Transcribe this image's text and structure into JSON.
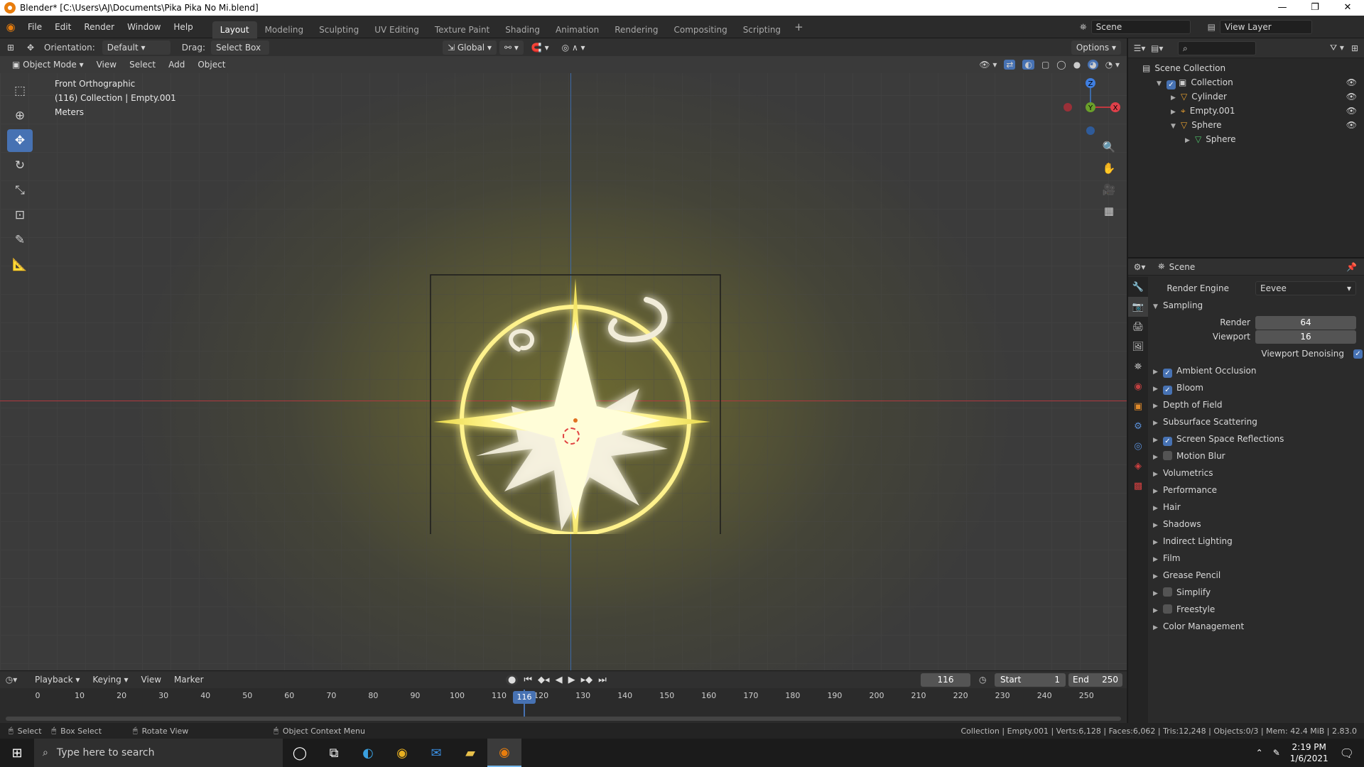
{
  "window": {
    "title": "Blender* [C:\\Users\\AJ\\Documents\\Pika Pika No Mi.blend]",
    "min": "—",
    "restore": "❐",
    "close": "✕"
  },
  "menus": [
    "File",
    "Edit",
    "Render",
    "Window",
    "Help"
  ],
  "workspaces": [
    "Layout",
    "Modeling",
    "Sculpting",
    "UV Editing",
    "Texture Paint",
    "Shading",
    "Animation",
    "Rendering",
    "Compositing",
    "Scripting"
  ],
  "active_workspace": "Layout",
  "scene_name": "Scene",
  "view_layer": "View Layer",
  "tool_header": {
    "orientation_label": "Orientation:",
    "orientation_value": "Default",
    "drag_label": "Drag:",
    "drag_value": "Select Box",
    "transform_value": "Global",
    "options_label": "Options"
  },
  "viewport_header": {
    "mode": "Object Mode",
    "menus": [
      "View",
      "Select",
      "Add",
      "Object"
    ]
  },
  "viewport_info": {
    "line1": "Front Orthographic",
    "line2": "(116) Collection | Empty.001",
    "line3": "Meters"
  },
  "gizmo": {
    "z": "Z",
    "y": "Y",
    "x": "X"
  },
  "outliner": {
    "rows": [
      {
        "label": "Scene Collection",
        "indent": 0
      },
      {
        "label": "Collection",
        "indent": 1
      },
      {
        "label": "Cylinder",
        "indent": 2
      },
      {
        "label": "Empty.001",
        "indent": 2
      },
      {
        "label": "Sphere",
        "indent": 2
      },
      {
        "label": "Sphere",
        "indent": 3
      }
    ]
  },
  "properties": {
    "context": "Scene",
    "render_engine_label": "Render Engine",
    "render_engine_value": "Eevee",
    "sampling_label": "Sampling",
    "render_label": "Render",
    "render_value": "64",
    "viewport_label": "Viewport",
    "viewport_value": "16",
    "viewport_denoising_label": "Viewport Denoising",
    "panels": [
      {
        "label": "Ambient Occlusion",
        "checkbox": true,
        "checked": true
      },
      {
        "label": "Bloom",
        "checkbox": true,
        "checked": true
      },
      {
        "label": "Depth of Field",
        "checkbox": false
      },
      {
        "label": "Subsurface Scattering",
        "checkbox": false
      },
      {
        "label": "Screen Space Reflections",
        "checkbox": true,
        "checked": true
      },
      {
        "label": "Motion Blur",
        "checkbox": true,
        "checked": false
      },
      {
        "label": "Volumetrics",
        "checkbox": false
      },
      {
        "label": "Performance",
        "checkbox": false
      },
      {
        "label": "Hair",
        "checkbox": false
      },
      {
        "label": "Shadows",
        "checkbox": false
      },
      {
        "label": "Indirect Lighting",
        "checkbox": false
      },
      {
        "label": "Film",
        "checkbox": false
      },
      {
        "label": "Grease Pencil",
        "checkbox": false
      },
      {
        "label": "Simplify",
        "checkbox": true,
        "checked": false
      },
      {
        "label": "Freestyle",
        "checkbox": true,
        "checked": false
      },
      {
        "label": "Color Management",
        "checkbox": false
      }
    ]
  },
  "timeline": {
    "menus": [
      "Playback",
      "Keying",
      "View",
      "Marker"
    ],
    "current_frame": "116",
    "start_label": "Start",
    "start_value": "1",
    "end_label": "End",
    "end_value": "250",
    "ticks": [
      "0",
      "10",
      "20",
      "30",
      "40",
      "50",
      "60",
      "70",
      "80",
      "90",
      "100",
      "110",
      "120",
      "130",
      "140",
      "150",
      "160",
      "170",
      "180",
      "190",
      "200",
      "210",
      "220",
      "230",
      "240",
      "250"
    ]
  },
  "statusbar": {
    "select": "Select",
    "box_select": "Box Select",
    "rotate_view": "Rotate View",
    "context_menu": "Object Context Menu",
    "stats": "Collection | Empty.001 | Verts:6,128 | Faces:6,062 | Tris:12,248 | Objects:0/3 | Mem: 42.4 MiB | 2.83.0"
  },
  "taskbar": {
    "search_placeholder": "Type here to search",
    "time": "2:19 PM",
    "date": "1/6/2021"
  },
  "colors": {
    "accent": "#4772b3",
    "axis_x": "#b0383f",
    "axis_z": "#3d6ba8",
    "glow": "#fff6a0"
  }
}
